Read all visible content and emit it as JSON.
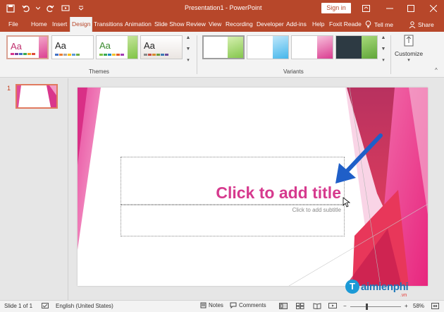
{
  "titlebar": {
    "title": "Presentation1 - PowerPoint",
    "signin_label": "Sign in"
  },
  "tabs": [
    "File",
    "Home",
    "Insert",
    "Design",
    "Transitions",
    "Animation",
    "Slide Show",
    "Review",
    "View",
    "Recording",
    "Developer",
    "Add-ins",
    "Help",
    "Foxit Reade"
  ],
  "active_tab": "Design",
  "tell_me": "Tell me",
  "share": "Share",
  "ribbon": {
    "themes": [
      {
        "aa": "Aa",
        "aa_color": "#c0306e",
        "accent": "#d9368c"
      },
      {
        "aa": "Aa",
        "aa_color": "#222222",
        "accent": "#ffffff"
      },
      {
        "aa": "Aa",
        "aa_color": "#3a8a2e",
        "accent": "#7cc242"
      },
      {
        "aa": "Aa",
        "aa_color": "#222222",
        "accent": "#cfcfcf"
      }
    ],
    "themes_label": "Themes",
    "variants_label": "Variants",
    "customize_label": "Customize"
  },
  "slide_panel": {
    "slide_number": "1"
  },
  "slide": {
    "title_placeholder": "Click to add title",
    "subtitle_placeholder": "Click to add subtitle"
  },
  "statusbar": {
    "slide_info": "Slide 1 of 1",
    "language": "English (United States)",
    "notes": "Notes",
    "comments": "Comments",
    "zoom": "58%"
  },
  "watermark": {
    "logo_letter": "T",
    "name": "aimienphi",
    "suffix": ".vn"
  },
  "colors": {
    "brand": "#b7472a",
    "pink": "#d9368c",
    "arrow": "#1f5fc8"
  }
}
